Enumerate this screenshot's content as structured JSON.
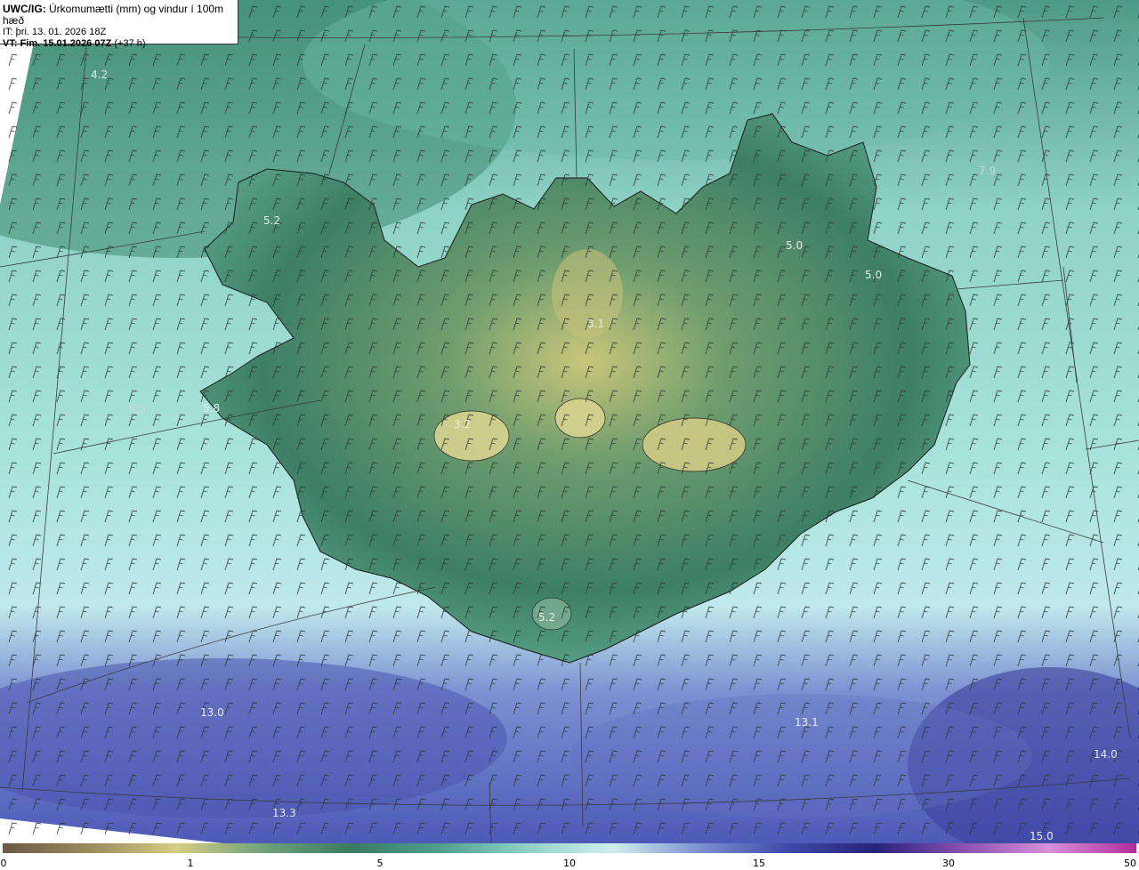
{
  "title": {
    "model": "UWC/IG:",
    "description": "Úrkomumætti (mm) og vindur í 100m hæð",
    "issue_time": "IT: þri. 13. 01. 2026 18Z",
    "valid_label": "VT: Fim. 15.01.2026 07Z",
    "valid_offset": "(+37 h)"
  },
  "values": [
    {
      "text": "4.2"
    },
    {
      "text": "5.2"
    },
    {
      "text": "3.1"
    },
    {
      "text": "5.0"
    },
    {
      "text": "5.0"
    },
    {
      "text": "7.9"
    },
    {
      "text": "9.3"
    },
    {
      "text": "5.8"
    },
    {
      "text": "3.2"
    },
    {
      "text": "5.2"
    },
    {
      "text": "13.0"
    },
    {
      "text": "13.1"
    },
    {
      "text": "13.3"
    },
    {
      "text": "14.0"
    },
    {
      "text": "15.0"
    }
  ],
  "colorbar": {
    "ticks": [
      "0",
      "1",
      "5",
      "10",
      "15",
      "30",
      "50"
    ],
    "colors": [
      "#6a5a45",
      "#9c8a5c",
      "#d6cc85",
      "#6fa27a",
      "#3b7a62",
      "#4f9e8e",
      "#8fd0c6",
      "#d0f0ee",
      "#7a90cf",
      "#3e4aa8",
      "#27237a",
      "#8a4fb0",
      "#d890d8",
      "#b02d9a"
    ]
  },
  "icons": {
    "wind_barb": "wind-barb-icon"
  }
}
